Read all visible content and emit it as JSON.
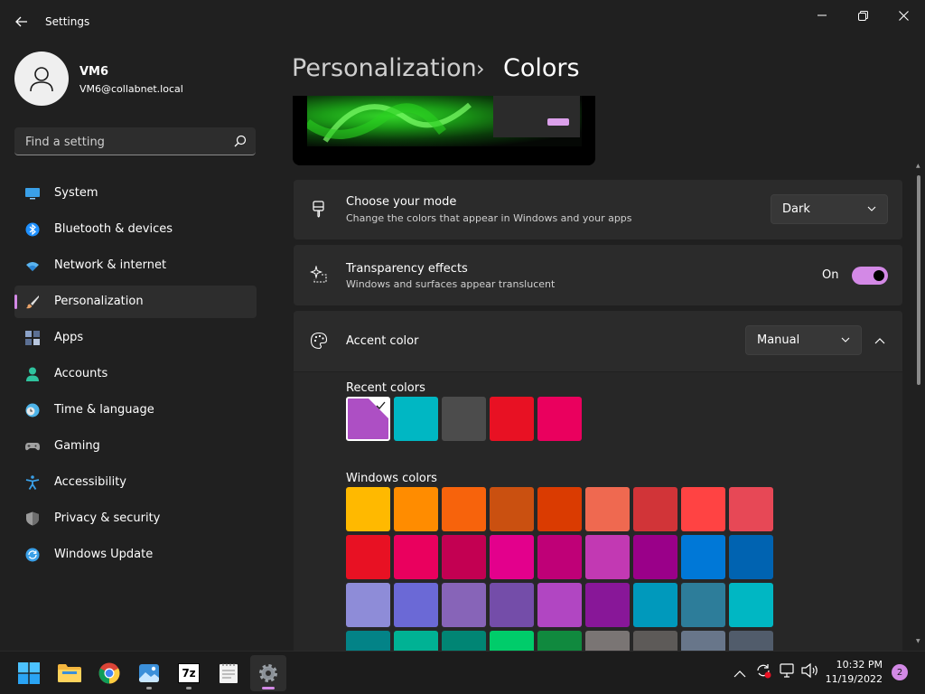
{
  "window": {
    "title": "Settings",
    "back_icon": "back-arrow-icon",
    "minimize_icon": "minimize-icon",
    "restore_icon": "restore-icon",
    "close_icon": "close-icon"
  },
  "profile": {
    "name": "VM6",
    "email": "VM6@collabnet.local",
    "avatar_icon": "user-avatar-icon"
  },
  "search": {
    "placeholder": "Find a setting",
    "icon": "search-icon"
  },
  "sidebar": {
    "items": [
      {
        "label": "System",
        "icon": "monitor-icon",
        "color": "#3aa0e8"
      },
      {
        "label": "Bluetooth & devices",
        "icon": "bluetooth-icon",
        "color": "#1e90ff"
      },
      {
        "label": "Network & internet",
        "icon": "wifi-icon",
        "color": "#5ab4f0"
      },
      {
        "label": "Personalization",
        "icon": "paintbrush-icon",
        "color": "#e8a36a",
        "active": true
      },
      {
        "label": "Apps",
        "icon": "apps-icon",
        "color": "#8ba2c8"
      },
      {
        "label": "Accounts",
        "icon": "person-icon",
        "color": "#2fc39e"
      },
      {
        "label": "Time & language",
        "icon": "clock-globe-icon",
        "color": "#4db3e8"
      },
      {
        "label": "Gaming",
        "icon": "gamepad-icon",
        "color": "#a0a0a0"
      },
      {
        "label": "Accessibility",
        "icon": "accessibility-icon",
        "color": "#3aa0e8"
      },
      {
        "label": "Privacy & security",
        "icon": "shield-icon",
        "color": "#9a9a9a"
      },
      {
        "label": "Windows Update",
        "icon": "update-icon",
        "color": "#3aa0e8"
      }
    ]
  },
  "header": {
    "parent": "Personalization",
    "separator": "›",
    "current": "Colors"
  },
  "mode": {
    "title": "Choose your mode",
    "description": "Change the colors that appear in Windows and your apps",
    "value": "Dark",
    "icon": "paint-bucket-icon"
  },
  "transparency": {
    "title": "Transparency effects",
    "description": "Windows and surfaces appear translucent",
    "state_label": "On",
    "enabled": true,
    "icon": "sparkle-icon"
  },
  "accent": {
    "title": "Accent color",
    "value": "Manual",
    "icon": "palette-icon",
    "accent_hex": "#d389e6"
  },
  "recent_colors": {
    "label": "Recent colors",
    "colors": [
      "#ad4fc4",
      "#00b7c3",
      "#4c4c4c",
      "#e81123",
      "#ea005e"
    ],
    "selected_index": 0
  },
  "windows_colors": {
    "label": "Windows colors",
    "rows": [
      [
        "#ffb900",
        "#ff8c00",
        "#f7630c",
        "#ca5010",
        "#da3b01",
        "#ef6950",
        "#d13438",
        "#ff4343",
        "#e74856"
      ],
      [
        "#e81123",
        "#ea005e",
        "#c30052",
        "#e3008c",
        "#bf0077",
        "#c239b3",
        "#9a0089",
        "#0078d7",
        "#0063b1"
      ],
      [
        "#8e8cd8",
        "#6b69d6",
        "#8764b8",
        "#744da9",
        "#b146c2",
        "#881798",
        "#0099bc",
        "#2d7d9a",
        "#00b7c3"
      ],
      [
        "#038387",
        "#00b294",
        "#018574",
        "#00cc6a",
        "#10893e",
        "#7a7574",
        "#5d5a58",
        "#68768a",
        "#515c6b"
      ]
    ]
  },
  "taskbar": {
    "apps": [
      {
        "name": "start",
        "icon": "windows-logo-icon"
      },
      {
        "name": "file-explorer",
        "icon": "folder-icon"
      },
      {
        "name": "chrome",
        "icon": "chrome-icon"
      },
      {
        "name": "photos",
        "icon": "photos-icon"
      },
      {
        "name": "7zip",
        "icon": "7zip-icon",
        "text": "7z"
      },
      {
        "name": "notepad",
        "icon": "notepad-icon"
      },
      {
        "name": "settings",
        "icon": "gear-icon",
        "active": true
      }
    ],
    "tray_icons": [
      "chevron-up-icon",
      "sync-icon",
      "network-icon",
      "volume-icon"
    ],
    "time": "10:32 PM",
    "date": "11/19/2022",
    "notification_count": "2"
  }
}
